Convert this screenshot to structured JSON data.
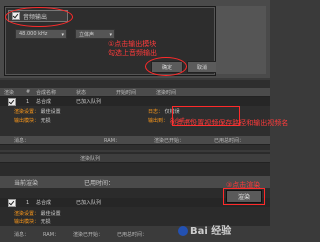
{
  "dialog": {
    "audio_output_label": "音频输出",
    "audio_format_value": "48.000 kHz",
    "audio_channel_value": "立体声",
    "annotation_1_line1": "①点击输出模块",
    "annotation_1_line2": "勾选上音频输出",
    "ok_label": "确定",
    "cancel_label": "取消"
  },
  "queue": {
    "columns": [
      "渲染",
      "#",
      "",
      "合成名称",
      "状态",
      "开始时间",
      "渲染时间"
    ],
    "row1": {
      "num": "1",
      "comp_name": "总合成",
      "status": "已加入队列"
    },
    "render_settings_label": "渲染设置：",
    "render_settings_value": "最佳设置",
    "output_module_label": "输出模块：",
    "output_module_value": "无损",
    "log_label": "日志：",
    "log_value": "仅错误",
    "output_to_label": "输出到：",
    "output_to_value": "总合成.avi",
    "annotation_2": "②点击设置视频保存路径和输出视频名"
  },
  "render": {
    "tab_label": "渲染队列",
    "current_render_label": "当前渲染",
    "elapsed_label": "已用时间：",
    "annotation_3": "③点击渲染",
    "render_button_label": "渲染",
    "row1": {
      "num": "1",
      "comp_name": "总合成",
      "status": "已加入队列"
    },
    "render_settings_label": "渲染设置：",
    "render_settings_value": "最佳设置",
    "output_module_label": "输出模块：",
    "output_module_value": "无损"
  },
  "status_bar": {
    "message_label": "消息：",
    "ram_label": "RAM：",
    "renders_started_label": "渲染已开始：",
    "total_time_label": "已用总时间："
  },
  "watermark": "Bai 经验"
}
